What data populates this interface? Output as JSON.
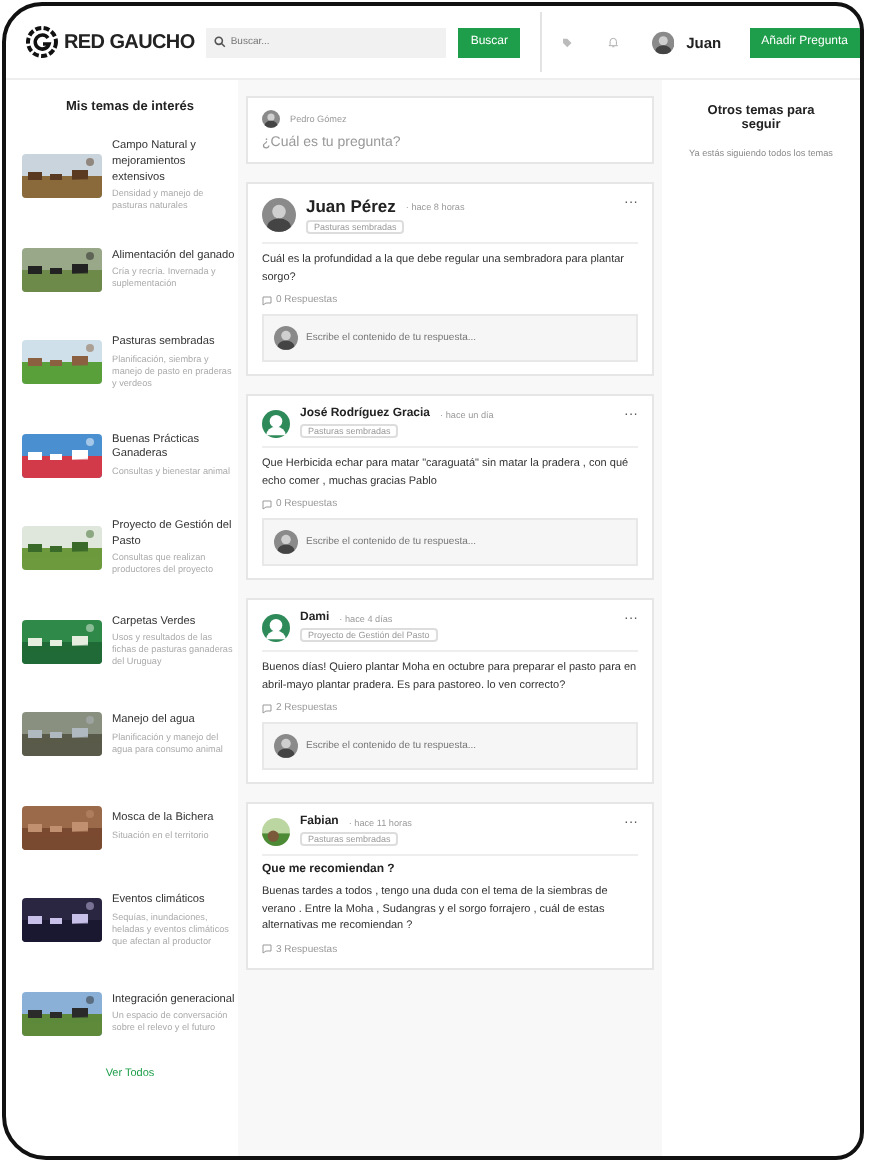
{
  "header": {
    "logo_text": "RED GAUCHO",
    "search": {
      "placeholder": "Buscar..."
    },
    "search_button": "Buscar",
    "user": {
      "name": "Juan"
    },
    "ask_button": "Añadir Pregunta"
  },
  "topics_panel": {
    "title": "Mis temas de interés",
    "see_all": "Ver Todos",
    "topics": [
      {
        "title": "Campo Natural y mejoramientos extensivos",
        "description": "Densidad y manejo de pasturas naturales"
      },
      {
        "title": "Alimentación del ganado",
        "description": "Cría y recría. Invernada y suplementación"
      },
      {
        "title": "Pasturas sembradas",
        "description": "Planificación, siembra y manejo de pasto en praderas y verdeos"
      },
      {
        "title": "Buenas Prácticas Ganaderas",
        "description": "Consultas y bienestar animal"
      },
      {
        "title": "Proyecto de Gestión del Pasto",
        "description": "Consultas que realizan productores del proyecto"
      },
      {
        "title": "Carpetas Verdes",
        "description": "Usos y resultados de las fichas de pasturas ganaderas del Uruguay"
      },
      {
        "title": "Manejo del agua",
        "description": "Planificación y manejo del agua para consumo animal"
      },
      {
        "title": "Mosca de la Bichera",
        "description": "Situación en el territorio"
      },
      {
        "title": "Eventos climáticos",
        "description": "Sequías, inundaciones, heladas y eventos climáticos que afectan al productor"
      },
      {
        "title": "Integración generacional",
        "description": "Un espacio de conversación sobre el relevo y el futuro"
      }
    ]
  },
  "composer": {
    "author": "Pedro Gómez",
    "placeholder": "¿Cuál es tu pregunta?"
  },
  "posts": [
    {
      "author": "Juan Pérez",
      "large_name": true,
      "time": "· hace 8 horas",
      "tag": "Pasturas sembradas",
      "menu": "···",
      "body": "Cuál es la profundidad a la que debe regular una sembradora para plantar sorgo?",
      "answers": "0 Respuestas",
      "reply_placeholder": "Escribe el contenido de tu respuesta..."
    },
    {
      "author": "José Rodríguez Gracia",
      "avatar": {
        "kind": "default"
      },
      "large_name": false,
      "time": "· hace un día",
      "tag": "Pasturas sembradas",
      "menu": "···",
      "body": "Que Herbicida echar para matar \"caraguatá\" sin matar la pradera , con qué echo comer , muchas gracias Pablo",
      "answers": "0 Respuestas",
      "reply_placeholder": "Escribe el contenido de tu respuesta..."
    },
    {
      "author": "Dami",
      "avatar": {
        "kind": "default"
      },
      "large_name": false,
      "time": "· hace 4 días",
      "tag": "Proyecto de Gestión del Pasto",
      "menu": "···",
      "body": "Buenos días! Quiero plantar Moha en octubre para preparar el pasto para en abril-mayo plantar pradera. Es para pastoreo. lo ven correcto?",
      "answers": "2 Respuestas",
      "reply_placeholder": "Escribe el contenido de tu respuesta..."
    },
    {
      "author": "Fabian",
      "avatar": {
        "kind": "landscape"
      },
      "large_name": false,
      "time": "· hace 11 horas",
      "tag": "Pasturas sembradas",
      "menu": "···",
      "title": "Que me recomiendan ?",
      "body": "Buenas tardes a todos , tengo una duda con el tema de la siembras de verano . Entre la Moha , Sudangras y el sorgo forrajero , cuál de estas alternativas me recomiendan ?",
      "answers": "3 Respuestas"
    }
  ],
  "right_panel": {
    "title": "Otros temas para seguir",
    "message": "Ya estás siguiendo todos los temas"
  }
}
